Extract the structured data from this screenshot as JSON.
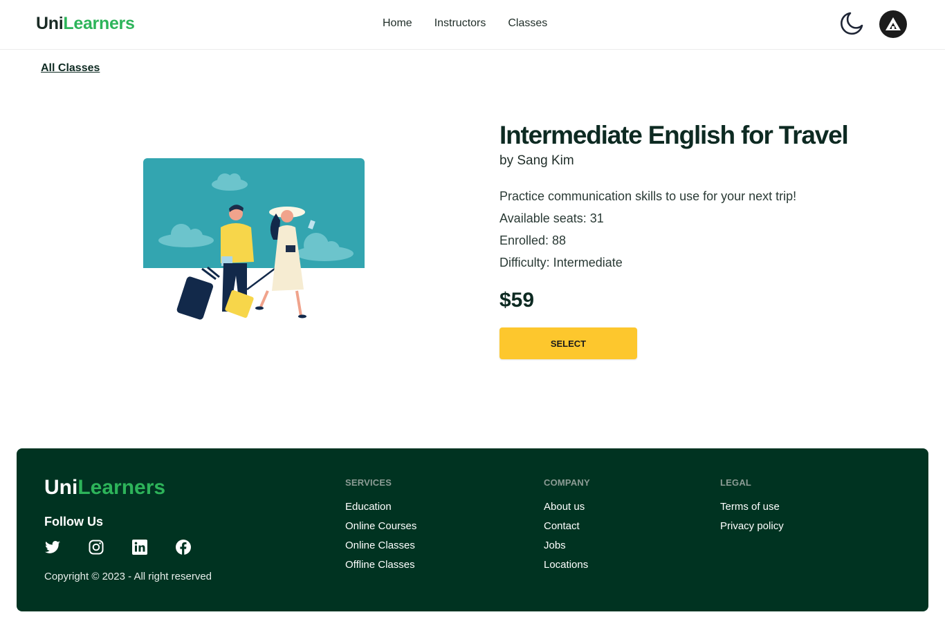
{
  "header": {
    "logo_a": "Uni",
    "logo_b": "Learners",
    "nav": [
      "Home",
      "Instructors",
      "Classes"
    ],
    "theme_icon": "moon-icon",
    "avatar_icon": "user-avatar"
  },
  "breadcrumb": {
    "back_label": "All Classes"
  },
  "class_detail": {
    "title": "Intermediate English for Travel",
    "instructor": "by Sang Kim",
    "description": "Practice communication skills to use for your next trip!",
    "seats": "Available seats: 31",
    "enrolled": "Enrolled: 88",
    "difficulty": "Difficulty: Intermediate",
    "price": "$59",
    "select_label": "SELECT"
  },
  "footer": {
    "logo_a": "Uni",
    "logo_b": "Learners",
    "follow_title": "Follow Us",
    "social_icons": [
      "twitter-icon",
      "instagram-icon",
      "linkedin-icon",
      "facebook-icon"
    ],
    "copyright": "Copyright © 2023 - All right reserved",
    "services": {
      "title": "SERVICES",
      "links": [
        "Education",
        "Online Courses",
        "Online Classes",
        "Offline Classes"
      ]
    },
    "company": {
      "title": "COMPANY",
      "links": [
        "About us",
        "Contact",
        "Jobs",
        "Locations"
      ]
    },
    "legal": {
      "title": "LEGAL",
      "links": [
        "Terms of use",
        "Privacy policy"
      ]
    }
  },
  "colors": {
    "brand_green": "#2db45a",
    "footer_bg": "#003321",
    "button_yellow": "#fdc72d",
    "illustration_teal": "#33a5b0"
  }
}
